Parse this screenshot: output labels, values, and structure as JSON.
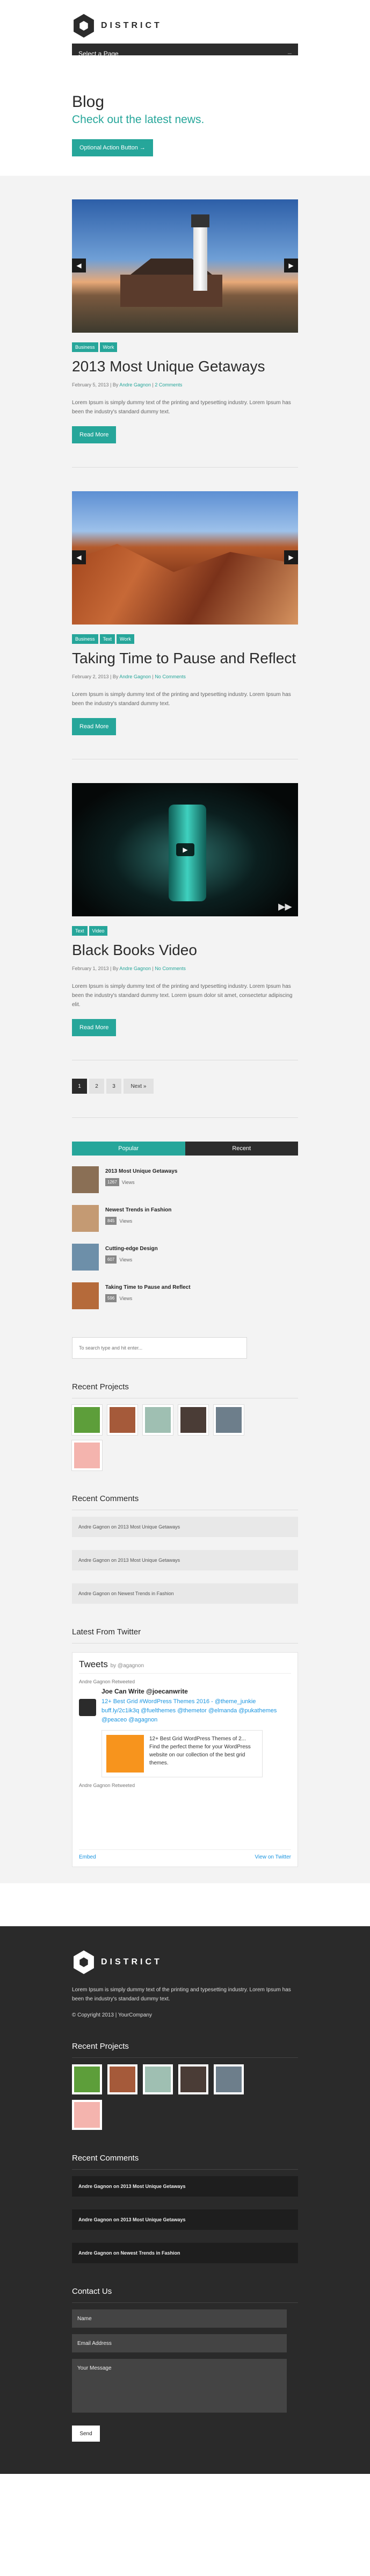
{
  "header": {
    "logo_text": "DISTRICT",
    "page_select": "Select a Page"
  },
  "banner": {
    "title": "Blog",
    "subtitle": "Check out the latest news.",
    "button": "Optional Action Button →"
  },
  "posts": [
    {
      "tags": [
        "Business",
        "Work"
      ],
      "title": "2013 Most Unique Getaways",
      "date": "February 5, 2013",
      "by": "By",
      "author": "Andre Gagnon",
      "comments": "2 Comments",
      "excerpt": "Lorem Ipsum is simply dummy text of the printing and typesetting industry. Lorem Ipsum has been the industry's standard dummy text.",
      "button": "Read More"
    },
    {
      "tags": [
        "Business",
        "Text",
        "Work"
      ],
      "title": "Taking Time to Pause and Reflect",
      "date": "February 2, 2013",
      "by": "By",
      "author": "Andre Gagnon",
      "comments": "No Comments",
      "excerpt": "Lorem Ipsum is simply dummy text of the printing and typesetting industry. Lorem Ipsum has been the industry's standard dummy text.",
      "button": "Read More"
    },
    {
      "tags": [
        "Text",
        "Video"
      ],
      "title": "Black Books Video",
      "date": "February 1, 2013",
      "by": "By",
      "author": "Andre Gagnon",
      "comments": "No Comments",
      "excerpt": "Lorem Ipsum is simply dummy text of the printing and typesetting industry. Lorem Ipsum has been the industry's standard dummy text. Lorem ipsum dolor sit amet, consectetur adipiscing elit.",
      "button": "Read More"
    }
  ],
  "pagination": {
    "pages": [
      "1",
      "2",
      "3"
    ],
    "next": "Next »"
  },
  "tabs": {
    "popular": "Popular",
    "recent": "Recent"
  },
  "popular": [
    {
      "title": "2013 Most Unique Getaways",
      "views": "1267",
      "label": "Views"
    },
    {
      "title": "Newest Trends in Fashion",
      "views": "845",
      "label": "Views"
    },
    {
      "title": "Cutting-edge Design",
      "views": "607",
      "label": "Views"
    },
    {
      "title": "Taking Time to Pause and Reflect",
      "views": "596",
      "label": "Views"
    }
  ],
  "search": {
    "placeholder": "To search type and hit enter..."
  },
  "recent_projects": {
    "title": "Recent Projects"
  },
  "recent_comments": {
    "title": "Recent Comments",
    "items": [
      "Andre Gagnon on 2013 Most Unique Getaways",
      "Andre Gagnon on 2013 Most Unique Getaways",
      "Andre Gagnon on Newest Trends in Fashion"
    ]
  },
  "twitter": {
    "title": "Latest From Twitter",
    "head": "Tweets",
    "head_by": "by @agagnon",
    "retweeted": "Andre Gagnon Retweeted",
    "name": "Joe Can Write @joecanwrite",
    "text": "12+ Best Grid #WordPress Themes 2016 - @theme_junkie buff.ly/2c1ik3q @fuelthemes @themetor @elmanda @pukathemes @peaceo @agagnon",
    "card": "12+ Best Grid WordPress Themes of 2... Find the perfect theme for your WordPress website on our collection of the best grid themes.",
    "retweeted2": "Andre Gagnon Retweeted",
    "embed": "Embed",
    "view": "View on Twitter"
  },
  "footer": {
    "logo_text": "DISTRICT",
    "about": "Lorem Ipsum is simply dummy text of the printing and typesetting industry. Lorem Ipsum has been the industry's standard dummy text.",
    "copyright": "© Copyright 2013 | YourCompany",
    "projects_title": "Recent Projects",
    "comments_title": "Recent Comments",
    "comments": [
      "Andre Gagnon on 2013 Most Unique Getaways",
      "Andre Gagnon on 2013 Most Unique Getaways",
      "Andre Gagnon on Newest Trends in Fashion"
    ],
    "contact_title": "Contact Us",
    "name_placeholder": "Name",
    "email_placeholder": "Email Address",
    "message_placeholder": "Your Message",
    "send": "Send"
  },
  "colors": {
    "accent": "#26a69a",
    "dark": "#2b2b2b",
    "footer_bg": "#2a2a2a"
  }
}
